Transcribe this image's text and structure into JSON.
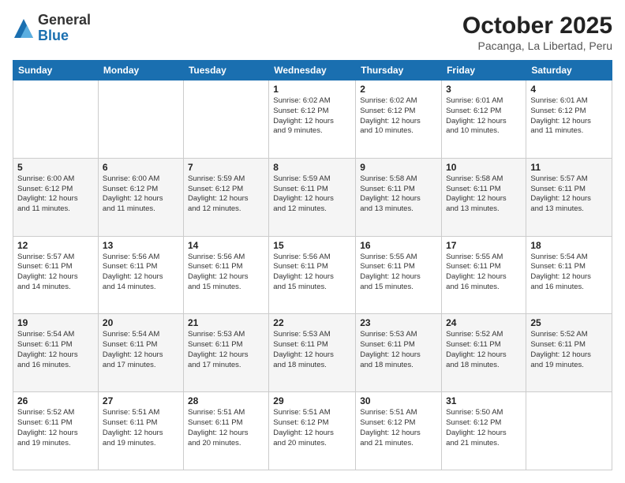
{
  "logo": {
    "general": "General",
    "blue": "Blue"
  },
  "header": {
    "month": "October 2025",
    "location": "Pacanga, La Libertad, Peru"
  },
  "weekdays": [
    "Sunday",
    "Monday",
    "Tuesday",
    "Wednesday",
    "Thursday",
    "Friday",
    "Saturday"
  ],
  "weeks": [
    [
      {
        "day": "",
        "info": ""
      },
      {
        "day": "",
        "info": ""
      },
      {
        "day": "",
        "info": ""
      },
      {
        "day": "1",
        "info": "Sunrise: 6:02 AM\nSunset: 6:12 PM\nDaylight: 12 hours\nand 9 minutes."
      },
      {
        "day": "2",
        "info": "Sunrise: 6:02 AM\nSunset: 6:12 PM\nDaylight: 12 hours\nand 10 minutes."
      },
      {
        "day": "3",
        "info": "Sunrise: 6:01 AM\nSunset: 6:12 PM\nDaylight: 12 hours\nand 10 minutes."
      },
      {
        "day": "4",
        "info": "Sunrise: 6:01 AM\nSunset: 6:12 PM\nDaylight: 12 hours\nand 11 minutes."
      }
    ],
    [
      {
        "day": "5",
        "info": "Sunrise: 6:00 AM\nSunset: 6:12 PM\nDaylight: 12 hours\nand 11 minutes."
      },
      {
        "day": "6",
        "info": "Sunrise: 6:00 AM\nSunset: 6:12 PM\nDaylight: 12 hours\nand 11 minutes."
      },
      {
        "day": "7",
        "info": "Sunrise: 5:59 AM\nSunset: 6:12 PM\nDaylight: 12 hours\nand 12 minutes."
      },
      {
        "day": "8",
        "info": "Sunrise: 5:59 AM\nSunset: 6:11 PM\nDaylight: 12 hours\nand 12 minutes."
      },
      {
        "day": "9",
        "info": "Sunrise: 5:58 AM\nSunset: 6:11 PM\nDaylight: 12 hours\nand 13 minutes."
      },
      {
        "day": "10",
        "info": "Sunrise: 5:58 AM\nSunset: 6:11 PM\nDaylight: 12 hours\nand 13 minutes."
      },
      {
        "day": "11",
        "info": "Sunrise: 5:57 AM\nSunset: 6:11 PM\nDaylight: 12 hours\nand 13 minutes."
      }
    ],
    [
      {
        "day": "12",
        "info": "Sunrise: 5:57 AM\nSunset: 6:11 PM\nDaylight: 12 hours\nand 14 minutes."
      },
      {
        "day": "13",
        "info": "Sunrise: 5:56 AM\nSunset: 6:11 PM\nDaylight: 12 hours\nand 14 minutes."
      },
      {
        "day": "14",
        "info": "Sunrise: 5:56 AM\nSunset: 6:11 PM\nDaylight: 12 hours\nand 15 minutes."
      },
      {
        "day": "15",
        "info": "Sunrise: 5:56 AM\nSunset: 6:11 PM\nDaylight: 12 hours\nand 15 minutes."
      },
      {
        "day": "16",
        "info": "Sunrise: 5:55 AM\nSunset: 6:11 PM\nDaylight: 12 hours\nand 15 minutes."
      },
      {
        "day": "17",
        "info": "Sunrise: 5:55 AM\nSunset: 6:11 PM\nDaylight: 12 hours\nand 16 minutes."
      },
      {
        "day": "18",
        "info": "Sunrise: 5:54 AM\nSunset: 6:11 PM\nDaylight: 12 hours\nand 16 minutes."
      }
    ],
    [
      {
        "day": "19",
        "info": "Sunrise: 5:54 AM\nSunset: 6:11 PM\nDaylight: 12 hours\nand 16 minutes."
      },
      {
        "day": "20",
        "info": "Sunrise: 5:54 AM\nSunset: 6:11 PM\nDaylight: 12 hours\nand 17 minutes."
      },
      {
        "day": "21",
        "info": "Sunrise: 5:53 AM\nSunset: 6:11 PM\nDaylight: 12 hours\nand 17 minutes."
      },
      {
        "day": "22",
        "info": "Sunrise: 5:53 AM\nSunset: 6:11 PM\nDaylight: 12 hours\nand 18 minutes."
      },
      {
        "day": "23",
        "info": "Sunrise: 5:53 AM\nSunset: 6:11 PM\nDaylight: 12 hours\nand 18 minutes."
      },
      {
        "day": "24",
        "info": "Sunrise: 5:52 AM\nSunset: 6:11 PM\nDaylight: 12 hours\nand 18 minutes."
      },
      {
        "day": "25",
        "info": "Sunrise: 5:52 AM\nSunset: 6:11 PM\nDaylight: 12 hours\nand 19 minutes."
      }
    ],
    [
      {
        "day": "26",
        "info": "Sunrise: 5:52 AM\nSunset: 6:11 PM\nDaylight: 12 hours\nand 19 minutes."
      },
      {
        "day": "27",
        "info": "Sunrise: 5:51 AM\nSunset: 6:11 PM\nDaylight: 12 hours\nand 19 minutes."
      },
      {
        "day": "28",
        "info": "Sunrise: 5:51 AM\nSunset: 6:11 PM\nDaylight: 12 hours\nand 20 minutes."
      },
      {
        "day": "29",
        "info": "Sunrise: 5:51 AM\nSunset: 6:12 PM\nDaylight: 12 hours\nand 20 minutes."
      },
      {
        "day": "30",
        "info": "Sunrise: 5:51 AM\nSunset: 6:12 PM\nDaylight: 12 hours\nand 21 minutes."
      },
      {
        "day": "31",
        "info": "Sunrise: 5:50 AM\nSunset: 6:12 PM\nDaylight: 12 hours\nand 21 minutes."
      },
      {
        "day": "",
        "info": ""
      }
    ]
  ]
}
